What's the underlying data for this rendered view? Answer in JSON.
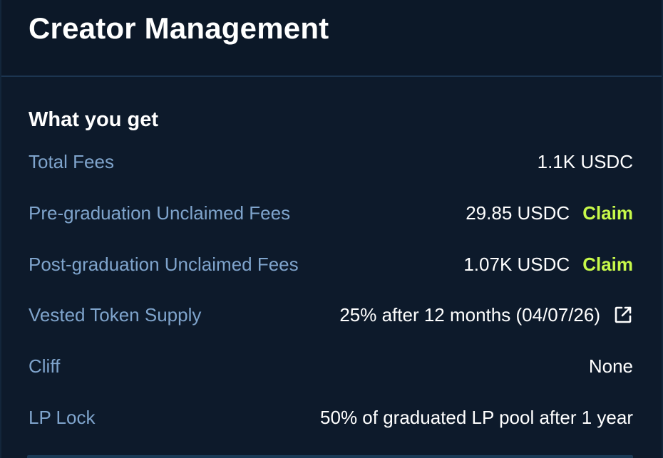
{
  "header": {
    "title": "Creator Management"
  },
  "section": {
    "title": "What you get"
  },
  "rows": [
    {
      "label": "Total Fees",
      "value": "1.1K USDC"
    },
    {
      "label": "Pre-graduation Unclaimed Fees",
      "value": "29.85 USDC",
      "action": "Claim"
    },
    {
      "label": "Post-graduation Unclaimed Fees",
      "value": "1.07K USDC",
      "action": "Claim"
    },
    {
      "label": "Vested Token Supply",
      "value": "25% after 12 months (04/07/26)",
      "icon": "external-link-icon"
    },
    {
      "label": "Cliff",
      "value": "None"
    },
    {
      "label": "LP Lock",
      "value": "50% of graduated LP pool after 1 year"
    }
  ],
  "colors": {
    "background": "#0d1a2b",
    "label": "#7fa4cc",
    "value": "#ffffff",
    "claim": "#c7f94a"
  }
}
